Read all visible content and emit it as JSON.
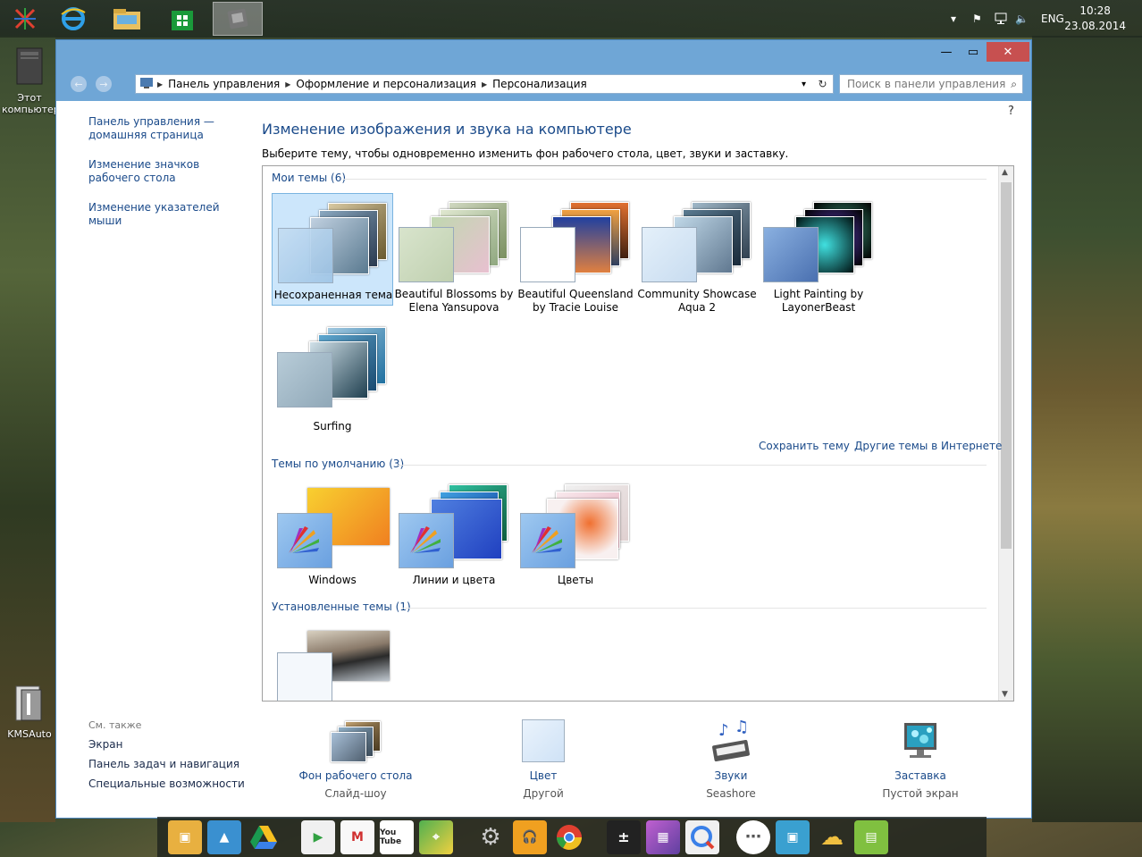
{
  "taskbar": {
    "tray_lang": "ENG",
    "clock_time": "10:28",
    "clock_date": "23.08.2014"
  },
  "desktop": {
    "icon_computer": "Этот компьютер",
    "icon_kms": "KMSAuto"
  },
  "address": {
    "crumb1": "Панель управления",
    "crumb2": "Оформление и персонализация",
    "crumb3": "Персонализация"
  },
  "search": {
    "placeholder": "Поиск в панели управления"
  },
  "left_nav": {
    "home": "Панель управления — домашняя страница",
    "desktop_icons": "Изменение значков рабочего стола",
    "mouse": "Изменение указателей мыши"
  },
  "see_also": {
    "header": "См. также",
    "screen": "Экран",
    "taskbar": "Панель задач и навигация",
    "access": "Специальные возможности"
  },
  "main": {
    "title": "Изменение изображения и звука на компьютере",
    "desc": "Выберите тему, чтобы одновременно изменить фон рабочего стола, цвет, звуки и заставку."
  },
  "sections": {
    "my": "Мои темы (6)",
    "default": "Темы по умолчанию (3)",
    "installed": "Установленные темы (1)"
  },
  "my_themes": [
    {
      "name": "Несохраненная тема"
    },
    {
      "name": "Beautiful Blossoms by Elena Yansupova"
    },
    {
      "name": "Beautiful Queensland by Tracie Louise"
    },
    {
      "name": "Community Showcase Aqua 2"
    },
    {
      "name": "Light Painting by LayonerBeast"
    },
    {
      "name": "Surfing"
    }
  ],
  "links": {
    "save": "Сохранить тему",
    "online": "Другие темы в Интернете"
  },
  "default_themes": [
    {
      "name": "Windows"
    },
    {
      "name": "Линии и цвета"
    },
    {
      "name": "Цветы"
    }
  ],
  "bottom": {
    "bg_label": "Фон рабочего стола",
    "bg_sub": "Слайд-шоу",
    "color_label": "Цвет",
    "color_sub": "Другой",
    "sound_label": "Звуки",
    "sound_sub": "Seashore",
    "saver_label": "Заставка",
    "saver_sub": "Пустой экран"
  },
  "dock_labels": {
    "youtube": "You Tube"
  }
}
